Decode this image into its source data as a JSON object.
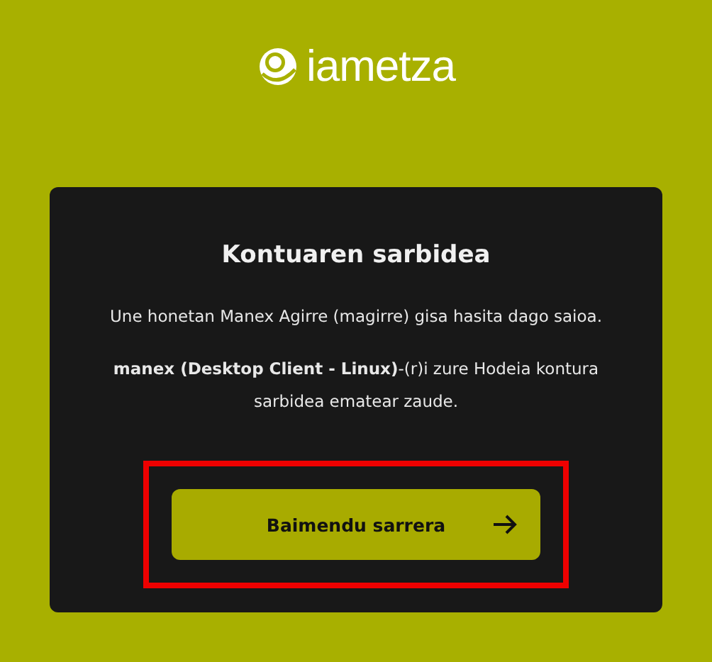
{
  "logo": {
    "text": "iametza"
  },
  "card": {
    "title": "Kontuaren sarbidea",
    "paragraphs": [
      "Une honetan Manex Agirre (magirre) gisa hasita dago saioa.",
      "**manex (Desktop Client - Linux)**-(r)i zure Hodeia kontura sarbidea ematear zaude."
    ],
    "button": {
      "label": "Baimendu sarrera",
      "highlighted": true
    }
  }
}
